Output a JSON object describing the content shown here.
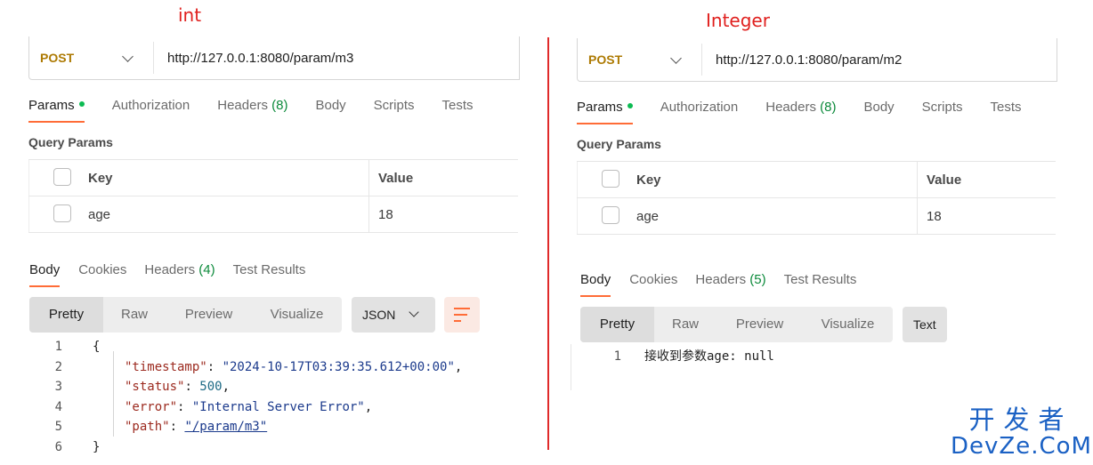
{
  "left": {
    "annotation": "int",
    "request": {
      "method": "POST",
      "url": "http://127.0.0.1:8080/param/m3"
    },
    "request_tabs": [
      {
        "label": "Params",
        "active": true,
        "dot": true
      },
      {
        "label": "Authorization"
      },
      {
        "label": "Headers",
        "count": "(8)"
      },
      {
        "label": "Body"
      },
      {
        "label": "Scripts"
      },
      {
        "label": "Tests"
      }
    ],
    "query_params_label": "Query Params",
    "table": {
      "key_header": "Key",
      "value_header": "Value",
      "rows": [
        {
          "key": "age",
          "value": "18"
        }
      ]
    },
    "response_tabs": [
      {
        "label": "Body",
        "active": true
      },
      {
        "label": "Cookies"
      },
      {
        "label": "Headers",
        "count": "(4)"
      },
      {
        "label": "Test Results"
      }
    ],
    "view_modes": [
      "Pretty",
      "Raw",
      "Preview",
      "Visualize"
    ],
    "format": "JSON",
    "code": {
      "line_numbers": [
        "1",
        "2",
        "3",
        "4",
        "5",
        "6"
      ],
      "open": "{",
      "close": "}",
      "fields": [
        {
          "key": "\"timestamp\"",
          "value": "\"2024-10-17T03:39:35.612+00:00\""
        },
        {
          "key": "\"status\"",
          "value": "500"
        },
        {
          "key": "\"error\"",
          "value": "\"Internal Server Error\""
        },
        {
          "key": "\"path\"",
          "value": "\"/param/m3\""
        }
      ]
    }
  },
  "right": {
    "annotation": "Integer",
    "request": {
      "method": "POST",
      "url": "http://127.0.0.1:8080/param/m2"
    },
    "request_tabs": [
      {
        "label": "Params",
        "active": true,
        "dot": true
      },
      {
        "label": "Authorization"
      },
      {
        "label": "Headers",
        "count": "(8)"
      },
      {
        "label": "Body"
      },
      {
        "label": "Scripts"
      },
      {
        "label": "Tests"
      }
    ],
    "query_params_label": "Query Params",
    "table": {
      "key_header": "Key",
      "value_header": "Value",
      "rows": [
        {
          "key": "age",
          "value": "18"
        }
      ]
    },
    "response_tabs": [
      {
        "label": "Body",
        "active": true
      },
      {
        "label": "Cookies"
      },
      {
        "label": "Headers",
        "count": "(5)"
      },
      {
        "label": "Test Results"
      }
    ],
    "view_modes": [
      "Pretty",
      "Raw",
      "Preview",
      "Visualize"
    ],
    "format": "Text",
    "code": {
      "line_numbers": [
        "1"
      ],
      "lines": [
        "接收到参数age: null"
      ]
    }
  },
  "watermark": {
    "top": "开发者",
    "bottom": "DevZe.CoM"
  },
  "colors": {
    "accent": "#ff6c37",
    "annotation": "#e0201e",
    "method": "#ad7a03",
    "watermark": "#1b61c4"
  }
}
